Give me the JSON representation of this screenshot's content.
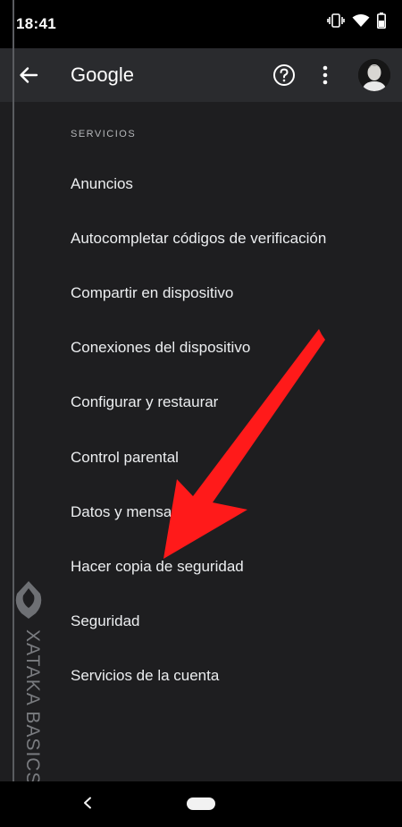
{
  "status_bar": {
    "time": "18:41",
    "icons": [
      "vibrate-icon",
      "wifi-icon",
      "battery-icon"
    ]
  },
  "app_bar": {
    "title": "Google",
    "back_icon": "arrow-back-icon",
    "help_icon": "help-circle-icon",
    "more_icon": "more-vert-icon",
    "avatar_icon": "user-avatar"
  },
  "content": {
    "section_header": "SERVICIOS",
    "items": [
      {
        "label": "Anuncios"
      },
      {
        "label": "Autocompletar códigos de verificación"
      },
      {
        "label": "Compartir en dispositivo"
      },
      {
        "label": "Conexiones del dispositivo"
      },
      {
        "label": "Configurar y restaurar"
      },
      {
        "label": "Control parental"
      },
      {
        "label": "Datos y mensajes"
      },
      {
        "label": "Hacer copia de seguridad"
      },
      {
        "label": "Seguridad"
      },
      {
        "label": "Servicios de la cuenta"
      }
    ]
  },
  "watermark": {
    "text": "XATAKA BASICS"
  },
  "nav_bar": {
    "back_icon": "nav-back-icon",
    "home_icon": "nav-home-pill-icon"
  },
  "annotation": {
    "arrow_color": "#ff1a1a"
  },
  "colors": {
    "background": "#1e1e20",
    "app_bar": "#2a2b2e",
    "text_primary": "#eceef0",
    "text_secondary": "#b6b8bb"
  }
}
